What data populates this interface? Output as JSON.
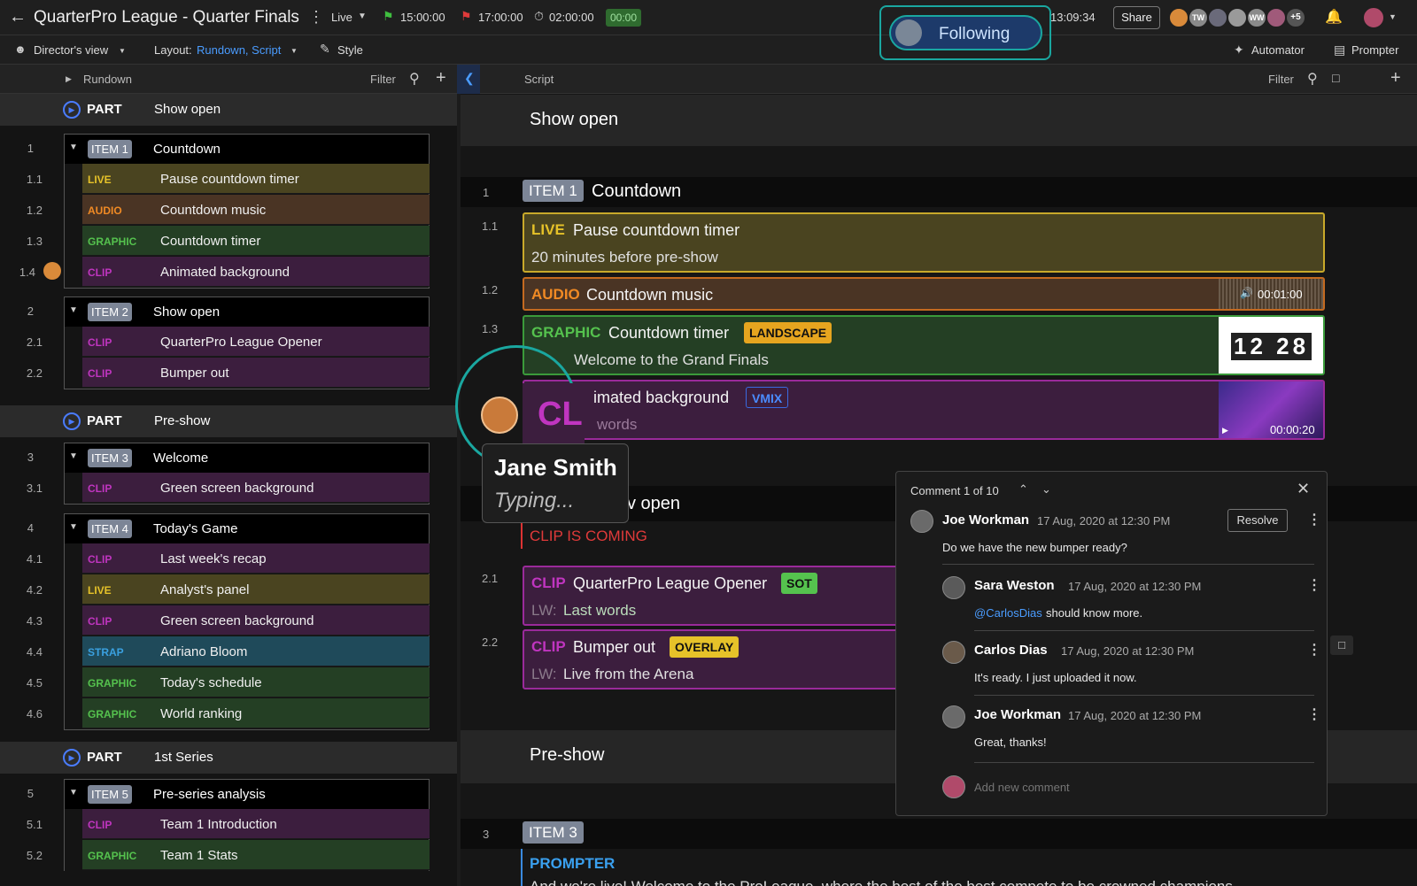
{
  "titlebar": {
    "title": "QuarterPro League - Quarter Finals",
    "mode": "Live",
    "start_time": "15:00:00",
    "end_time": "17:00:00",
    "duration": "02:00:00",
    "elapsed": "00:00",
    "clock": "13:09:34",
    "share_label": "Share",
    "avatars_extra": "+5",
    "avatar_initials": [
      "TW",
      "WW"
    ]
  },
  "toolbar": {
    "view": "Director's view",
    "layout_label": "Layout:",
    "layout_value": "Rundown, Script",
    "style": "Style",
    "automator": "Automator",
    "prompter": "Prompter"
  },
  "following": {
    "label": "Following"
  },
  "rundown": {
    "header": "Rundown",
    "filter": "Filter",
    "parts": [
      {
        "kind": "PART",
        "name": "Show open"
      },
      {
        "kind": "PART",
        "name": "Pre-show"
      },
      {
        "kind": "PART",
        "name": "1st Series"
      }
    ],
    "items": [
      {
        "num": "1",
        "tag": "ITEM 1",
        "name": "Countdown",
        "rows": [
          {
            "num": "1.1",
            "type": "LIVE",
            "name": "Pause countdown timer"
          },
          {
            "num": "1.2",
            "type": "AUDIO",
            "name": "Countdown music"
          },
          {
            "num": "1.3",
            "type": "GRAPHIC",
            "name": "Countdown timer"
          },
          {
            "num": "1.4",
            "type": "CLIP",
            "name": "Animated background"
          }
        ]
      },
      {
        "num": "2",
        "tag": "ITEM 2",
        "name": "Show open",
        "rows": [
          {
            "num": "2.1",
            "type": "CLIP",
            "name": "QuarterPro League Opener"
          },
          {
            "num": "2.2",
            "type": "CLIP",
            "name": "Bumper out"
          }
        ]
      },
      {
        "num": "3",
        "tag": "ITEM 3",
        "name": "Welcome",
        "rows": [
          {
            "num": "3.1",
            "type": "CLIP",
            "name": "Green screen background"
          }
        ]
      },
      {
        "num": "4",
        "tag": "ITEM 4",
        "name": "Today's Game",
        "rows": [
          {
            "num": "4.1",
            "type": "CLIP",
            "name": "Last week's recap"
          },
          {
            "num": "4.2",
            "type": "LIVE",
            "name": "Analyst's panel"
          },
          {
            "num": "4.3",
            "type": "CLIP",
            "name": "Green screen background"
          },
          {
            "num": "4.4",
            "type": "STRAP",
            "name": "Adriano Bloom"
          },
          {
            "num": "4.5",
            "type": "GRAPHIC",
            "name": "Today's schedule"
          },
          {
            "num": "4.6",
            "type": "GRAPHIC",
            "name": "World ranking"
          }
        ]
      },
      {
        "num": "5",
        "tag": "ITEM 5",
        "name": "Pre-series analysis",
        "rows": [
          {
            "num": "5.1",
            "type": "CLIP",
            "name": "Team 1 Introduction"
          },
          {
            "num": "5.2",
            "type": "GRAPHIC",
            "name": "Team 1 Stats"
          }
        ]
      }
    ]
  },
  "script": {
    "header": "Script",
    "filter": "Filter",
    "section1": "Show open",
    "item1": {
      "num": "1",
      "tag": "ITEM 1",
      "name": "Countdown"
    },
    "c11": {
      "num": "1.1",
      "type": "LIVE",
      "name": "Pause countdown timer",
      "sub": "20 minutes before pre-show"
    },
    "c12": {
      "num": "1.2",
      "type": "AUDIO",
      "name": "Countdown music",
      "duration": "00:01:00"
    },
    "c13": {
      "num": "1.3",
      "type": "GRAPHIC",
      "name": "Countdown timer",
      "badge": "LANDSCAPE",
      "sub": "Welcome to the Grand Finals",
      "thumb_text": "12 28"
    },
    "c14": {
      "type": "CLI",
      "name": "imated background",
      "badge": "VMIX",
      "sub": "words",
      "duration": "00:00:20"
    },
    "item2_name": "v open",
    "note": "CLIP IS COMING",
    "c21": {
      "num": "2.1",
      "type": "CLIP",
      "name": "QuarterPro League Opener",
      "badge": "SOT",
      "lw": "LW:",
      "sub": "Last words"
    },
    "c22": {
      "num": "2.2",
      "type": "CLIP",
      "name": "Bumper out",
      "badge": "OVERLAY",
      "lw": "LW:",
      "sub": "Live from the Arena"
    },
    "section2": "Pre-show",
    "item3": {
      "num": "3",
      "tag": "ITEM 3"
    },
    "prompter": "PROMPTER",
    "prompter_text": "And we're live! Welcome to the ProLeague, where the best of the best compete to be crowned champions"
  },
  "typing": {
    "name": "Jane Smith",
    "status": "Typing..."
  },
  "comments": {
    "counter": "Comment 1 of 10",
    "resolve": "Resolve",
    "add_placeholder": "Add new comment",
    "list": [
      {
        "name": "Joe Workman",
        "date": "17 Aug, 2020 at 12:30 PM",
        "text": "Do we have the new bumper ready?"
      },
      {
        "name": "Sara Weston",
        "date": "17 Aug, 2020 at 12:30 PM",
        "mention": "@CarlosDias",
        "text": " should know more."
      },
      {
        "name": "Carlos Dias",
        "date": "17 Aug, 2020 at 12:30 PM",
        "text": "It's ready. I just uploaded it now."
      },
      {
        "name": "Joe Workman",
        "date": "17 Aug, 2020 at 12:30 PM",
        "text": "Great, thanks!"
      }
    ]
  },
  "colors": {
    "LIVE": "#e6c229",
    "AUDIO": "#f08a24",
    "GRAPHIC": "#55c24e",
    "CLIP": "#c035c0",
    "STRAP": "#3aa0e0",
    "LIVE_bg": "#4a4420",
    "AUDIO_bg": "#4a3424",
    "GRAPHIC_bg": "#243f24",
    "CLIP_bg": "#3c1e3e",
    "STRAP_bg": "#1f4a5a",
    "accent": "#1aa7a0",
    "following_bg": "#1d3a6a",
    "link": "#4a9cff"
  }
}
